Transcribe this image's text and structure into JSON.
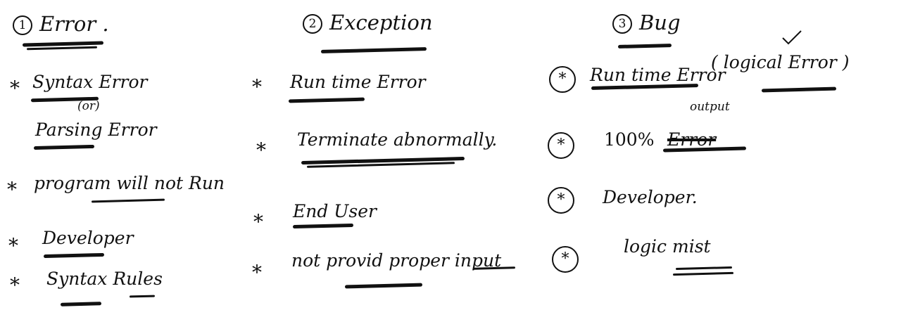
{
  "error": {
    "heading": "Error .",
    "number": "1",
    "items": [
      {
        "star": "*",
        "text": "Syntax Error"
      },
      {
        "text": "(or)"
      },
      {
        "text": "Parsing Error"
      },
      {
        "star": "*",
        "text": "program will not Run"
      },
      {
        "star": "*",
        "text": "Developer"
      },
      {
        "star": "*",
        "text": "Syntax Rules"
      }
    ]
  },
  "exception": {
    "heading": "Exception",
    "number": "2",
    "items": [
      {
        "star": "*",
        "text": "Run time Error"
      },
      {
        "star": "*",
        "text": "Terminate abnormally."
      },
      {
        "star": "*",
        "text": "End User"
      },
      {
        "star": "*",
        "text": "not provid proper input"
      }
    ]
  },
  "bug": {
    "heading": "Bug",
    "number": "3",
    "items": [
      {
        "star": "*",
        "text": "Run time Error",
        "aside": "( logical Error )"
      },
      {
        "star": "*",
        "text": "100%",
        "correction": "output",
        "crossed": "Error"
      },
      {
        "star": "*",
        "text": "Developer."
      },
      {
        "star": "*",
        "text": "logic mist"
      }
    ]
  }
}
